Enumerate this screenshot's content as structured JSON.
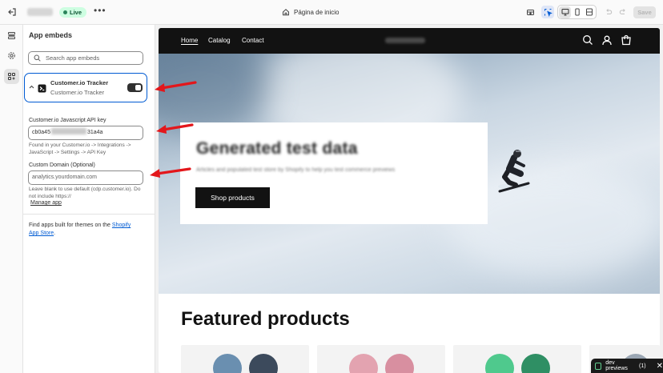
{
  "topbar": {
    "live_label": "Live",
    "page_label": "Página de inicio",
    "save_label": "Save"
  },
  "sidebar": {
    "title": "App embeds",
    "search_placeholder": "Search app embeds",
    "embed": {
      "name": "Customer.io Tracker",
      "subtitle": "Customer.io Tracker",
      "enabled": true
    },
    "api_key": {
      "label": "Customer.io Javascript API key",
      "value_start": "cb0a45",
      "value_end": "31a4a",
      "help": "Found in your Customer.io -> Integrations -> JavaScript -> Settings -> API Key"
    },
    "domain": {
      "label": "Custom Domain (Optional)",
      "placeholder": "analytics.yourdomain.com",
      "help": "Leave blank to use default (cdp.customer.io). Do not include https://"
    },
    "manage_link": "Manage app",
    "footer_text": "Find apps built for themes on the ",
    "footer_link": "Shopify App Store",
    "footer_end": "."
  },
  "store": {
    "nav": [
      "Home",
      "Catalog",
      "Contact"
    ],
    "hero_title": "Generated test data",
    "hero_subtitle": "Articles and populated test store by Shopify to help you test commerce previews",
    "hero_button": "Shop products",
    "featured_title": "Featured products"
  },
  "dev_bubble": {
    "label": "dev previews",
    "count": "(1)"
  },
  "colors": {
    "accent": "#005bd3",
    "annotation_arrow": "#e3171b",
    "live_badge_bg": "#cdfee1",
    "store_nav_bg": "#121212"
  }
}
